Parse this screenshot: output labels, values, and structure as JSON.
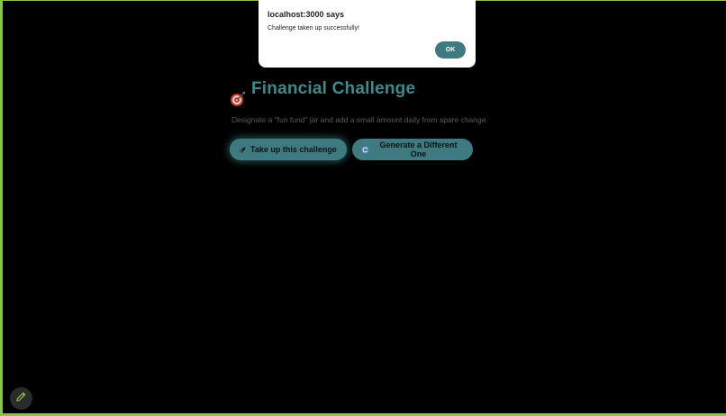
{
  "dialog": {
    "title": "localhost:3000 says",
    "message": "Challenge taken up successfully!",
    "ok_label": "OK"
  },
  "challenge": {
    "icon": "target-icon",
    "title": "Financial Challenge",
    "description": "Designate a \"fun fund\" jar and add a small amount daily from spare change."
  },
  "actions": {
    "take_up_label": "Take up this challenge",
    "take_up_icon": "rocket-icon",
    "generate_label": "Generate a Different One",
    "generate_icon": "refresh-icon"
  },
  "fab": {
    "icon": "pencil-icon"
  },
  "colors": {
    "accent": "#3e7a80",
    "title": "#3e8a8a",
    "frame": "#8bc34a",
    "background": "#000000"
  }
}
